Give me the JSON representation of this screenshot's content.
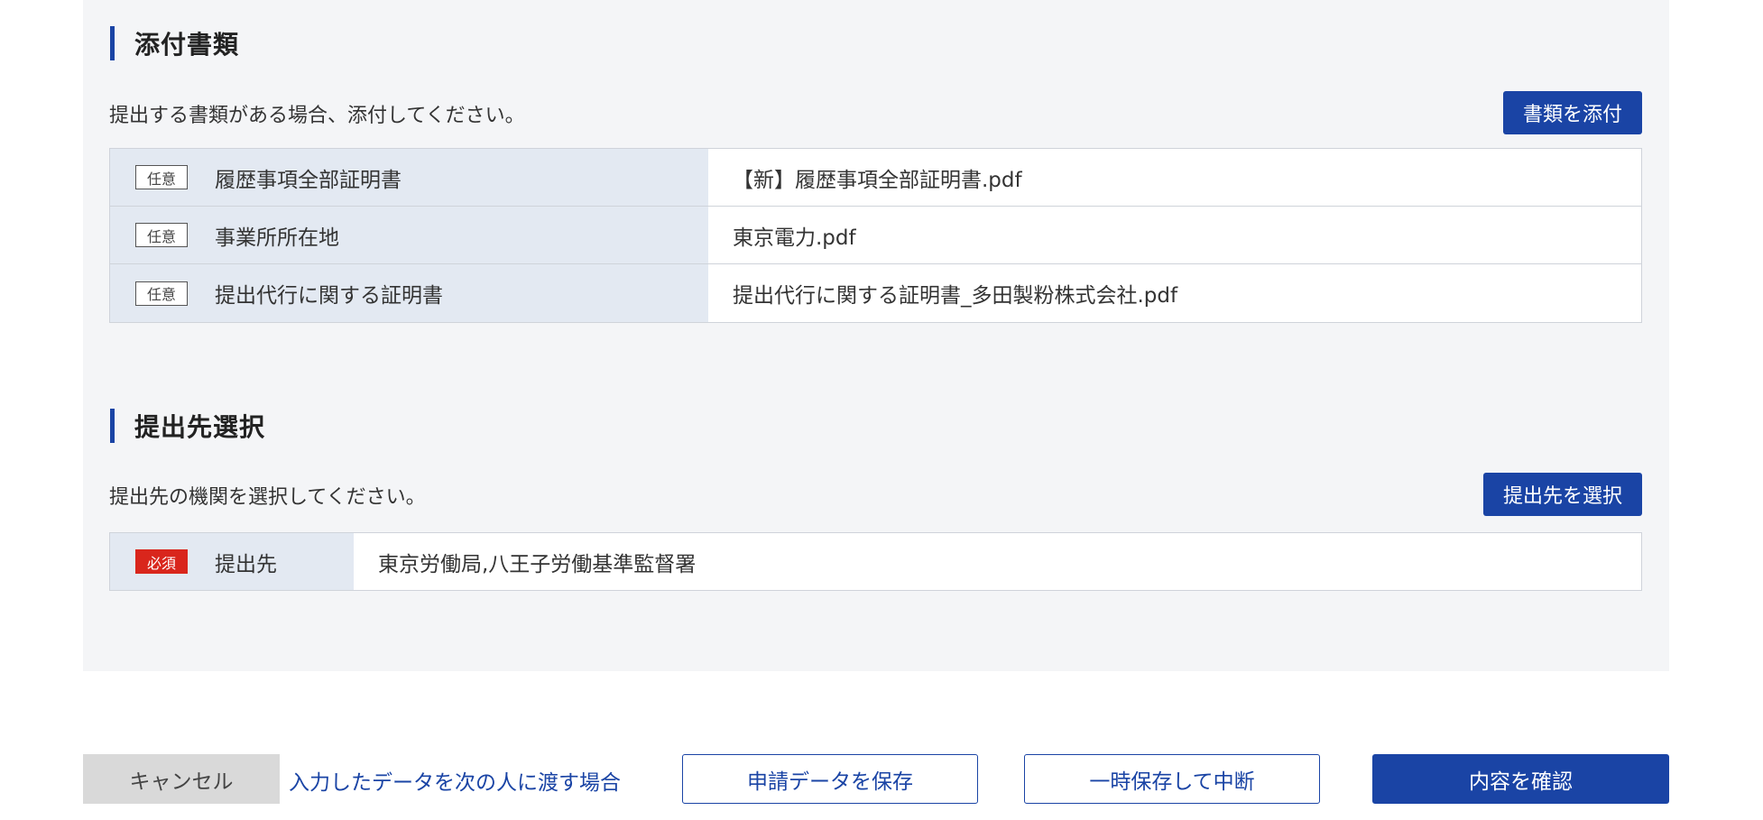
{
  "attachments": {
    "title": "添付書類",
    "description": "提出する書類がある場合、添付してください。",
    "attach_button": "書類を添付",
    "rows": [
      {
        "tag": "任意",
        "label": "履歴事項全部証明書",
        "file": "【新】履歴事項全部証明書.pdf"
      },
      {
        "tag": "任意",
        "label": "事業所所在地",
        "file": "東京電力.pdf"
      },
      {
        "tag": "任意",
        "label": "提出代行に関する証明書",
        "file": "提出代行に関する証明書_多田製粉株式会社.pdf"
      }
    ]
  },
  "destination": {
    "title": "提出先選択",
    "description": "提出先の機関を選択してください。",
    "select_button": "提出先を選択",
    "tag": "必須",
    "label": "提出先",
    "value": "東京労働局,八王子労働基準監督署"
  },
  "footer": {
    "cancel": "キャンセル",
    "handover_link": "入力したデータを次の人に渡す場合",
    "save": "申請データを保存",
    "suspend": "一時保存して中断",
    "confirm": "内容を確認"
  },
  "colors": {
    "accent": "#1a44a5",
    "required": "#d9261c",
    "panel_bg": "#f4f5f7",
    "label_bg": "#e3e9f2"
  }
}
